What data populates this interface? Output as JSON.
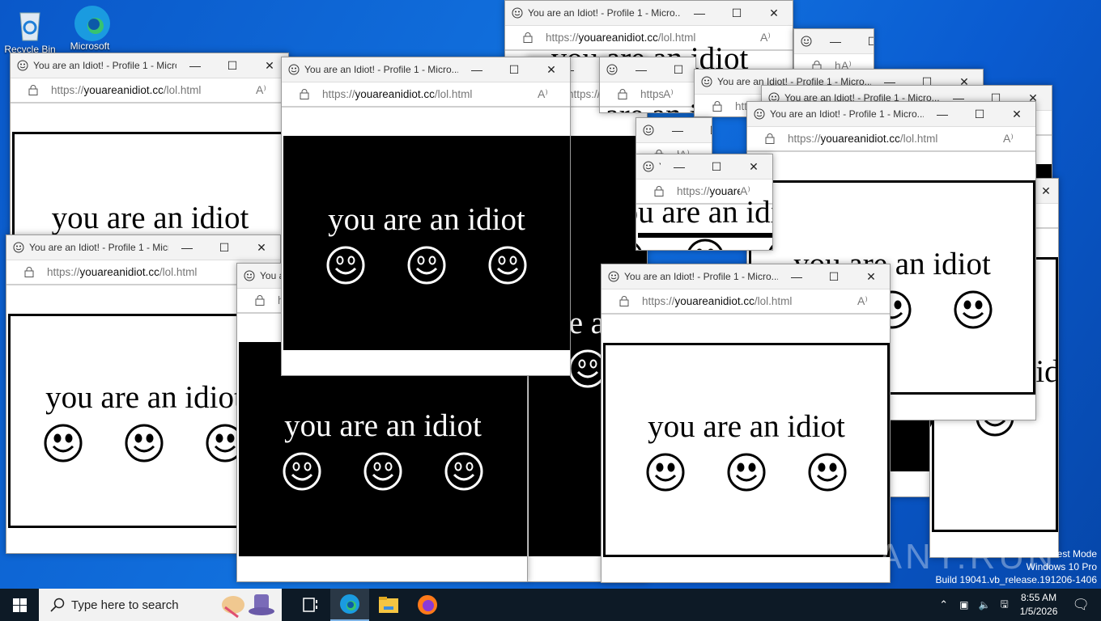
{
  "desktop": {
    "icons": [
      {
        "label": "Recycle Bin"
      },
      {
        "label": "Microsoft Edge"
      }
    ]
  },
  "window_template": {
    "title": "You are an Idiot! - Profile 1 - Micro...",
    "url_scheme": "https://",
    "url_host": "youareanidiot.cc",
    "url_path": "/lol.html",
    "heading": "you are an idiot",
    "controls": {
      "minimize": "—",
      "maximize": "☐",
      "close": "✕"
    },
    "read_aloud": "A⁾"
  },
  "windows": [
    {
      "theme": "white"
    },
    {
      "theme": "black"
    },
    {
      "theme": "white"
    },
    {
      "theme": "white"
    },
    {
      "theme": "black"
    },
    {
      "theme": "white"
    },
    {
      "theme": "white"
    },
    {
      "theme": "white"
    },
    {
      "theme": "white"
    },
    {
      "theme": "black"
    },
    {
      "theme": "black"
    },
    {
      "theme": "white"
    }
  ],
  "taskbar": {
    "search_placeholder": "Type here to search",
    "time": "8:55 AM",
    "date": "1/5/2026"
  },
  "watermark": {
    "brand": "ANY.RUN",
    "line1": "Test Mode",
    "line2": "Windows 10 Pro",
    "line3": "Build 19041.vb_release.191206-1406"
  }
}
